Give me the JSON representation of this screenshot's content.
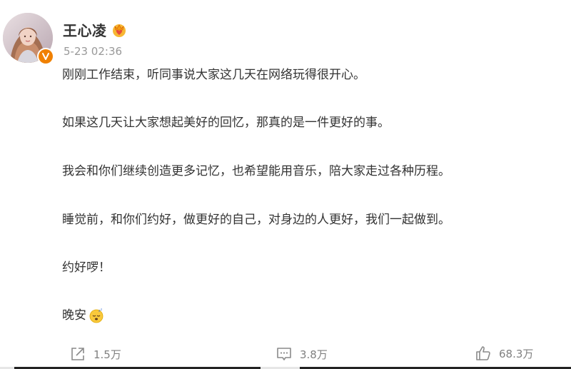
{
  "post": {
    "username": "王心凌",
    "timestamp": "5-23 02:36",
    "paragraphs": [
      "刚刚工作结束，听同事说大家这几天在网络玩得很开心。",
      "如果这几天让大家想起美好的回忆，那真的是一件更好的事。",
      "我会和你们继续创造更多记忆，也希望能用音乐，陪大家走过各种历程。",
      "睡觉前，和你们约好，做更好的自己，对身边的人更好，我们一起做到。",
      "约好啰！",
      "晚安"
    ],
    "emojis": {
      "name_badge": "crown-heart-icon",
      "goodnight": "sleeping-face-icon"
    }
  },
  "actions": {
    "repost": {
      "icon": "share-icon",
      "count": "1.5万"
    },
    "comment": {
      "icon": "comment-icon",
      "count": "3.8万"
    },
    "like": {
      "icon": "thumbs-up-icon",
      "count": "68.3万"
    }
  },
  "colors": {
    "text": "#333333",
    "muted": "#999999",
    "verified": "#f08000"
  }
}
